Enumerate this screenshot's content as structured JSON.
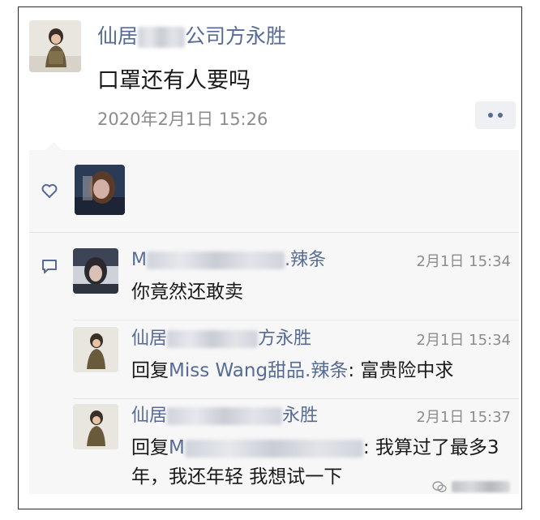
{
  "post": {
    "author_prefix": "仙居",
    "author_suffix": "公司方永胜",
    "text": "口罩还有人要吗",
    "timestamp": "2020年2月1日 15:26"
  },
  "likes": {
    "icon": "heart-outline-icon"
  },
  "comments": [
    {
      "author_prefix": "M",
      "author_suffix": ".辣条",
      "time": "2月1日 15:34",
      "text": "你竟然还敢卖"
    },
    {
      "author_prefix": "仙居",
      "author_suffix": "方永胜",
      "time": "2月1日 15:34",
      "reply_label": "回复",
      "reply_to": "Miss Wang甜品.辣条",
      "text": ": 富贵险中求"
    },
    {
      "author_prefix": "仙居",
      "author_suffix": "永胜",
      "time": "2月1日 15:37",
      "reply_label": "回复",
      "reply_to": "M",
      "text": ": 我算过了最多3年，我还年轻 我想试一下"
    }
  ],
  "colors": {
    "link_blue": "#576b95",
    "panel_bg": "#f7f7f7",
    "timestamp_gray": "#8c8c8c"
  }
}
